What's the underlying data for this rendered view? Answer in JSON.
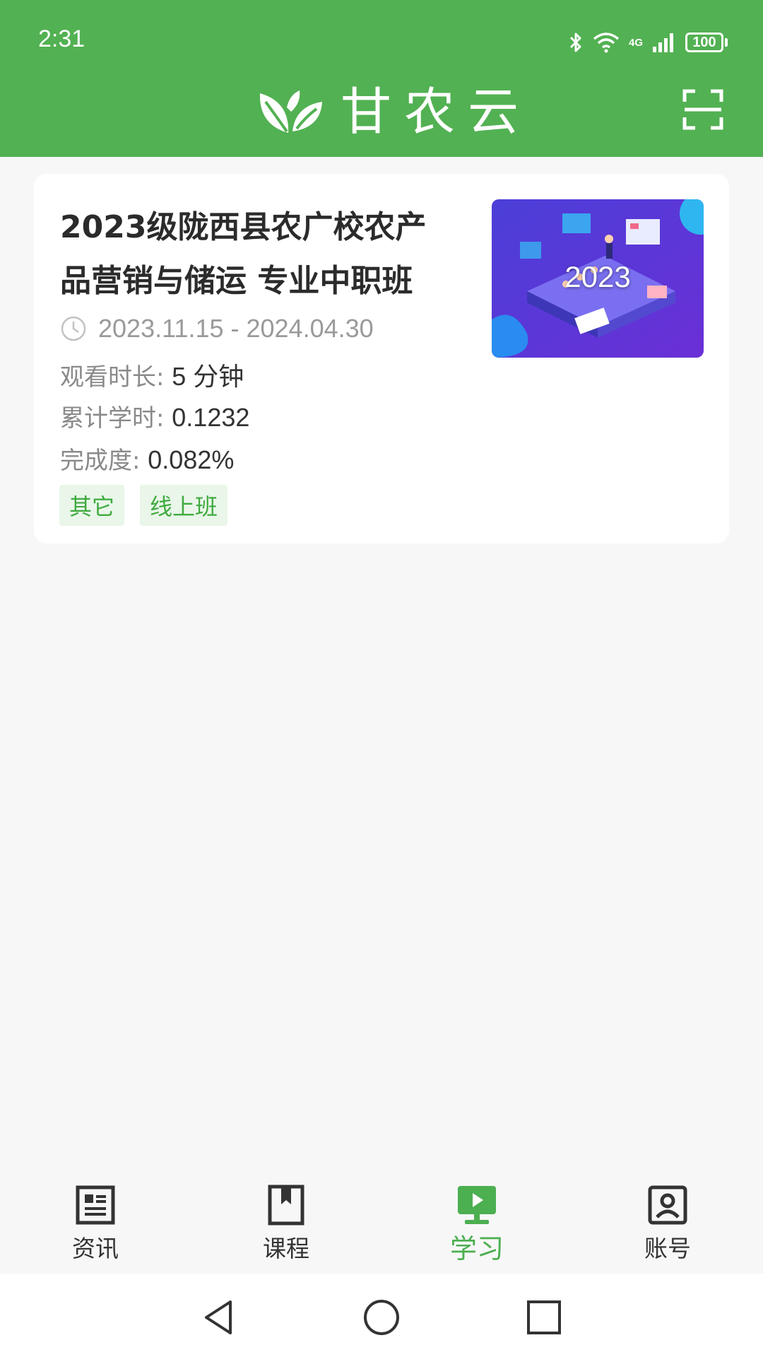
{
  "status_bar": {
    "time": "2:31",
    "battery": "100",
    "network_label": "4G",
    "icons": [
      "bluetooth-icon",
      "wifi-icon",
      "signal-icon",
      "battery-icon"
    ]
  },
  "header": {
    "app_name": "甘农云",
    "logo": "leaf-logo",
    "action_icon": "scan-icon",
    "background": "#52b152"
  },
  "course": {
    "title": "2023级陇西县农广校农产品营销与储运 专业中职班",
    "date_range": "2023.11.15 - 2024.04.30",
    "watch_time_label": "观看时长:",
    "watch_time_value": "5 分钟",
    "credit_hours_label": "累计学时:",
    "credit_hours_value": "0.1232",
    "completion_label": "完成度:",
    "completion_value": "0.082%",
    "tags": [
      "其它",
      "线上班"
    ],
    "thumbnail_text": "2023"
  },
  "bottom_nav": {
    "items": [
      {
        "label": "资讯",
        "icon": "news-icon",
        "active": false
      },
      {
        "label": "课程",
        "icon": "bookmark-icon",
        "active": false
      },
      {
        "label": "学习",
        "icon": "monitor-play-icon",
        "active": true
      },
      {
        "label": "账号",
        "icon": "account-icon",
        "active": false
      }
    ],
    "active_color": "#4caf50"
  },
  "system_nav": {
    "buttons": [
      "back-icon",
      "home-icon",
      "recents-icon"
    ]
  }
}
